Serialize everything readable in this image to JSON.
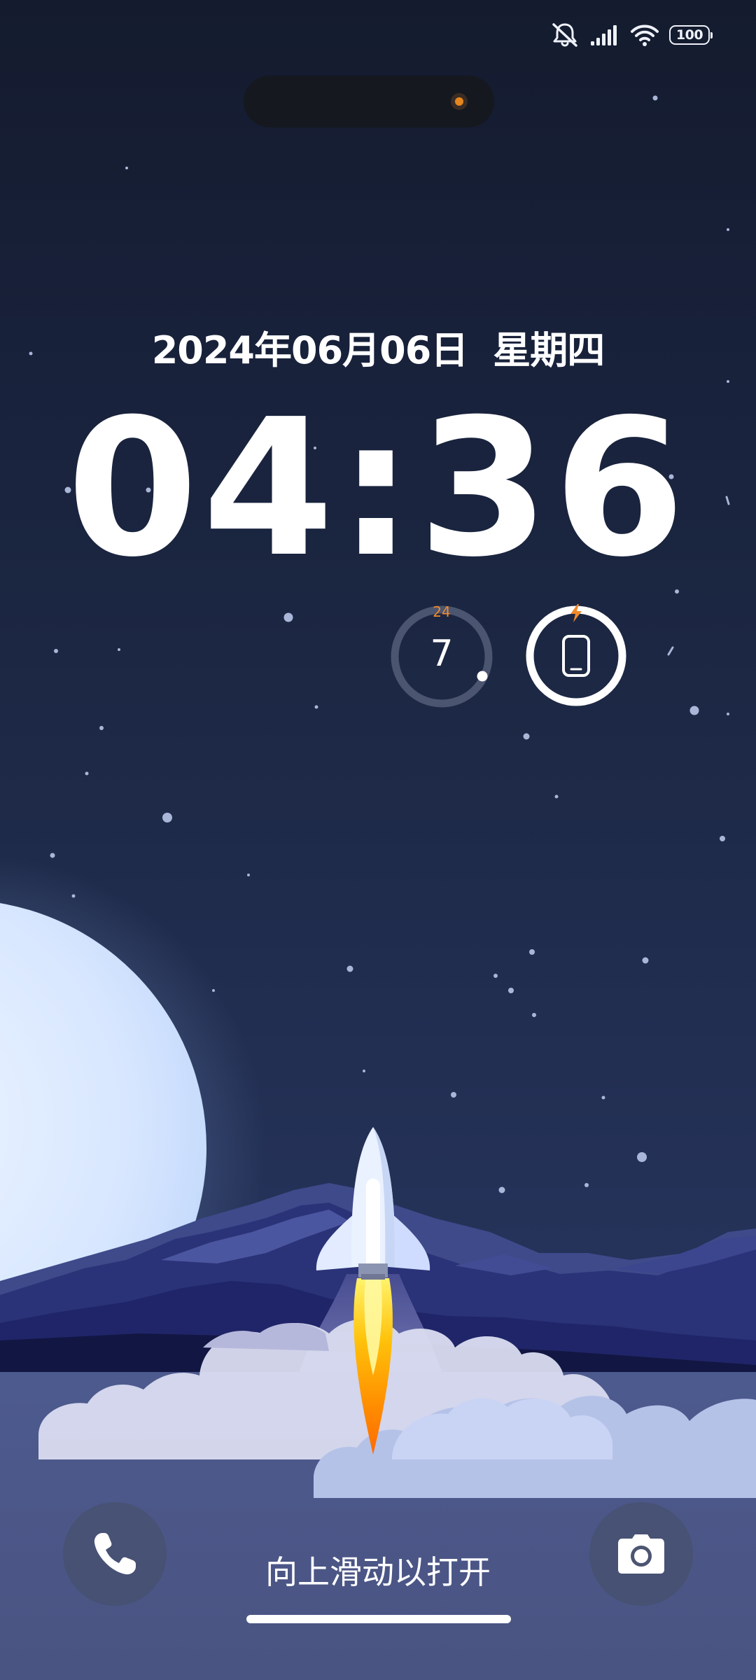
{
  "status_bar": {
    "icons": [
      "bell-muted-icon",
      "cellular-signal-icon",
      "wifi-icon"
    ],
    "battery_level": "100"
  },
  "lockscreen": {
    "date": "2024年06月06日",
    "weekday": "星期四",
    "time": "04:36"
  },
  "widgets": {
    "steps": {
      "label_top": "24",
      "value": "7",
      "icon": "ring-progress"
    },
    "battery": {
      "icon": "phone-icon",
      "status_icon": "charging-bolt-icon"
    }
  },
  "bottom": {
    "left_shortcut_icon": "phone-icon",
    "right_shortcut_icon": "camera-icon",
    "unlock_hint": "向上滑动以打开"
  },
  "colors": {
    "accent_orange": "#f08a2c",
    "sky_top": "#141b2e",
    "sky_bottom": "#2c3a66",
    "moon": "#dbe8ff"
  }
}
